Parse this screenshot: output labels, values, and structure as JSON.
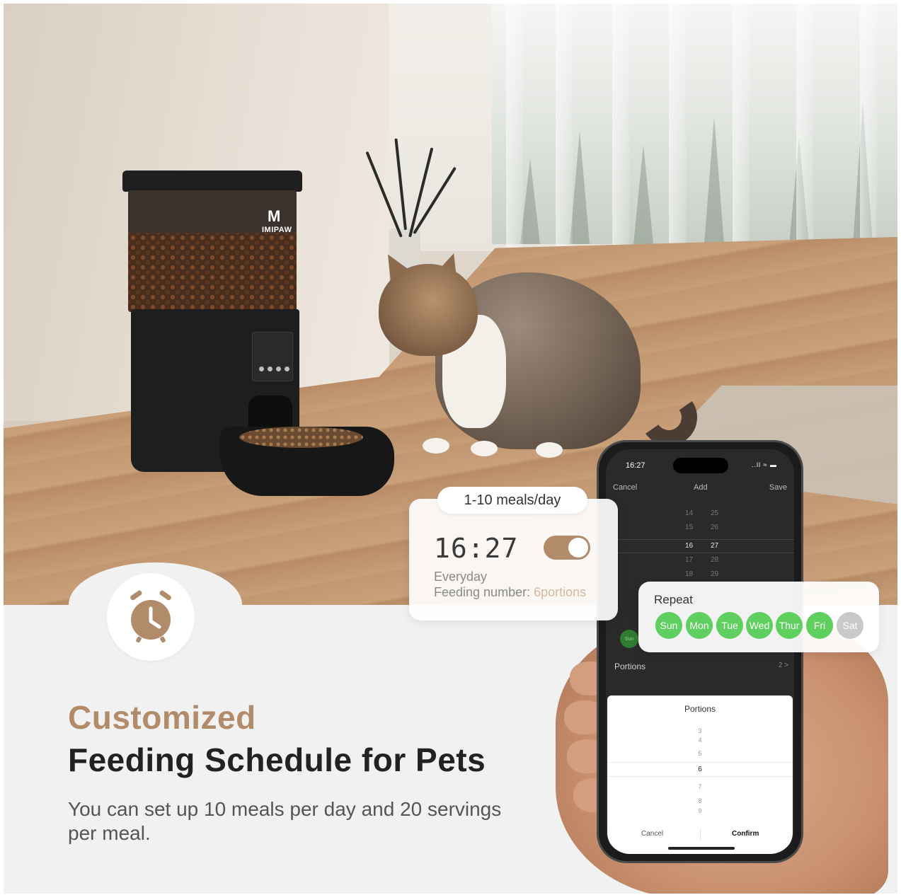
{
  "brand": {
    "logo_mark": "M",
    "logo_text": "IMIPAW"
  },
  "headline": {
    "line1": "Customized",
    "line2": "Feeding Schedule for Pets",
    "description": "You can set up 10 meals per day and 20 servings per meal."
  },
  "meal_card": {
    "pill_label": "1-10 meals/day",
    "time": "16:27",
    "toggle_on": true,
    "frequency": "Everyday",
    "feeding_label": "Feeding number: ",
    "feeding_value": "6portions"
  },
  "repeat_card": {
    "label": "Repeat",
    "days": [
      {
        "label": "Sun",
        "active": true
      },
      {
        "label": "Mon",
        "active": true
      },
      {
        "label": "Tue",
        "active": true
      },
      {
        "label": "Wed",
        "active": true
      },
      {
        "label": "Thur",
        "active": true
      },
      {
        "label": "Fri",
        "active": true
      },
      {
        "label": "Sat",
        "active": false
      }
    ]
  },
  "phone": {
    "status_time": "16:27",
    "status_icons": "..ll ≈ ▬",
    "nav": {
      "cancel": "Cancel",
      "title": "Add",
      "save": "Save"
    },
    "time_picker": {
      "rows": [
        {
          "hour": "14",
          "minute": "25"
        },
        {
          "hour": "15",
          "minute": "26"
        },
        {
          "hour": "16",
          "minute": "27"
        },
        {
          "hour": "17",
          "minute": "28"
        },
        {
          "hour": "18",
          "minute": "29"
        }
      ],
      "selected_index": 2
    },
    "sun_badge": "Sun",
    "portions_label": "Portions",
    "portions_value": "2 >",
    "sheet": {
      "title": "Portions",
      "options": [
        "3",
        "4",
        "5",
        "6",
        "7",
        "8",
        "9"
      ],
      "selected": "6",
      "cancel": "Cancel",
      "confirm": "Confirm"
    }
  },
  "colors": {
    "accent_brown": "#b28b6b",
    "day_active": "#5fd05f",
    "day_inactive": "#c9c9c9",
    "heading_dark": "#222222"
  },
  "icons": {
    "clock": "alarm-clock-icon"
  }
}
